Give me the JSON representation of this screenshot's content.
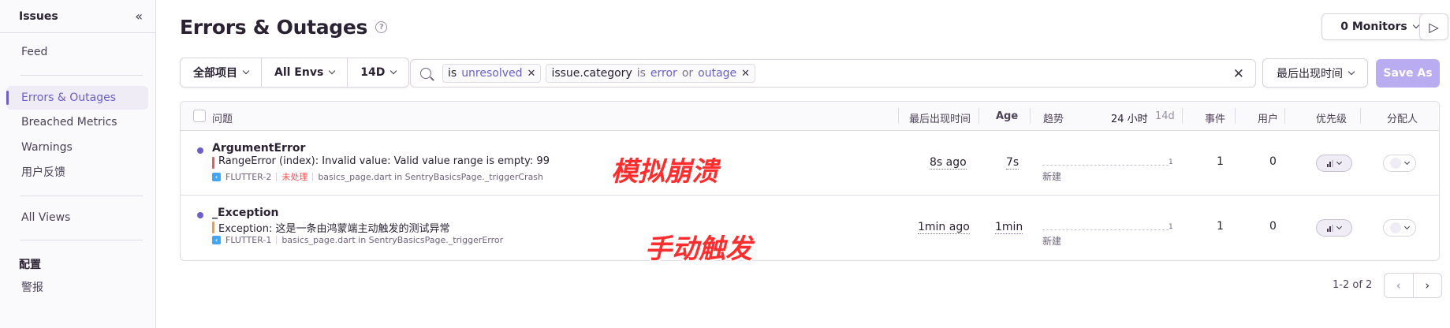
{
  "sidebar": {
    "title": "Issues",
    "collapse_icon": "«",
    "items": [
      {
        "label": "Feed"
      },
      {
        "label": "Errors & Outages"
      },
      {
        "label": "Breached Metrics"
      },
      {
        "label": "Warnings"
      },
      {
        "label": "用户反馈"
      },
      {
        "label": "All Views"
      }
    ],
    "section_title": "配置",
    "section_items": [
      {
        "label": "警报"
      }
    ]
  },
  "header": {
    "title": "Errors & Outages",
    "help_icon": "?",
    "monitors_label": "0 Monitors",
    "play_icon": "▷"
  },
  "filters": {
    "project": "全部项目",
    "envs": "All Envs",
    "period": "14D",
    "search_tokens": [
      {
        "key": "is",
        "op": "",
        "values": [
          "unresolved"
        ],
        "joiner": ""
      },
      {
        "key": "issue.category",
        "op": "is",
        "values": [
          "error",
          "outage"
        ],
        "joiner": "or"
      }
    ],
    "clear_icon": "✕",
    "sort_label": "最后出现时间",
    "save_as": "Save As"
  },
  "table": {
    "headers": {
      "issue": "问题",
      "last_seen": "最后出现时间",
      "age": "Age",
      "trend": "趋势",
      "period_24h": "24 小时",
      "period_14d": "14d",
      "events": "事件",
      "users": "用户",
      "priority": "优先级",
      "assignee": "分配人"
    },
    "rows": [
      {
        "title": "ArgumentError",
        "message": "RangeError (index): Invalid value: Valid value range is empty: 99",
        "short_id": "FLUTTER-2",
        "unhandled": "未处理",
        "culprit": "basics_page.dart in SentryBasicsPage._triggerCrash",
        "last_seen": "8s ago",
        "age": "7s",
        "spark_max": "1",
        "status": "新建",
        "events": "1",
        "users": "0"
      },
      {
        "title": "_Exception",
        "message": "Exception: 这是一条由鸿蒙端主动触发的测试异常",
        "short_id": "FLUTTER-1",
        "unhandled": "",
        "culprit": "basics_page.dart in SentryBasicsPage._triggerError",
        "last_seen": "1min ago",
        "age": "1min",
        "spark_max": "1",
        "status": "新建",
        "events": "1",
        "users": "0"
      }
    ]
  },
  "annotations": {
    "row1": "模拟崩溃",
    "row2": "手动触发"
  },
  "pagination": {
    "text": "1-2 of 2",
    "prev_icon": "‹",
    "next_icon": "›"
  },
  "colors": {
    "accent": "#6c5fc7",
    "save_disabled": "#b9acf0",
    "unhandled": "#f55459",
    "annotation": "#ff2d2d"
  }
}
